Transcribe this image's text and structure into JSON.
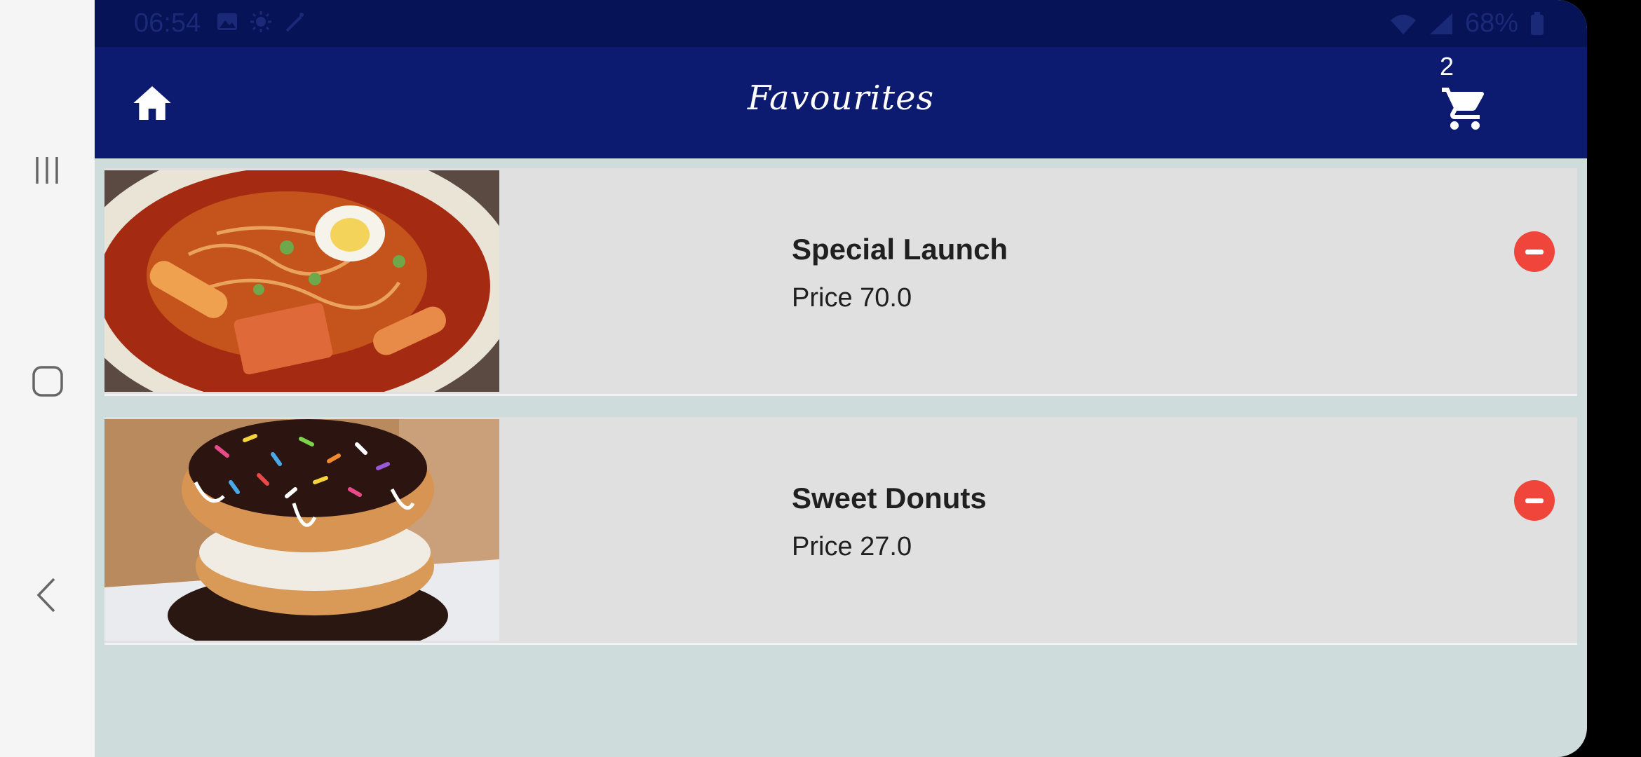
{
  "status_bar": {
    "time": "06:54",
    "battery": "68%",
    "icons": [
      "image-icon",
      "brightness-icon",
      "wand-icon",
      "wifi-icon",
      "signal-icon",
      "battery-icon"
    ]
  },
  "app_bar": {
    "title": "Favourites",
    "cart_count": "2",
    "background_color": "#0c1a70",
    "icons": [
      "home-icon",
      "cart-icon"
    ]
  },
  "favourites": [
    {
      "name": "Special Launch",
      "price": "Price 70.0",
      "image": "spicy-noodle-dish-photo"
    },
    {
      "name": "Sweet Donuts",
      "price": "Price 27.0",
      "image": "sprinkled-donuts-photo"
    }
  ],
  "colors": {
    "remove_button": "#f0453a",
    "card_background": "#e0e0e0",
    "page_background": "#cfdcdc"
  },
  "system_nav": [
    "recents-icon",
    "home-circle-icon",
    "back-icon"
  ]
}
